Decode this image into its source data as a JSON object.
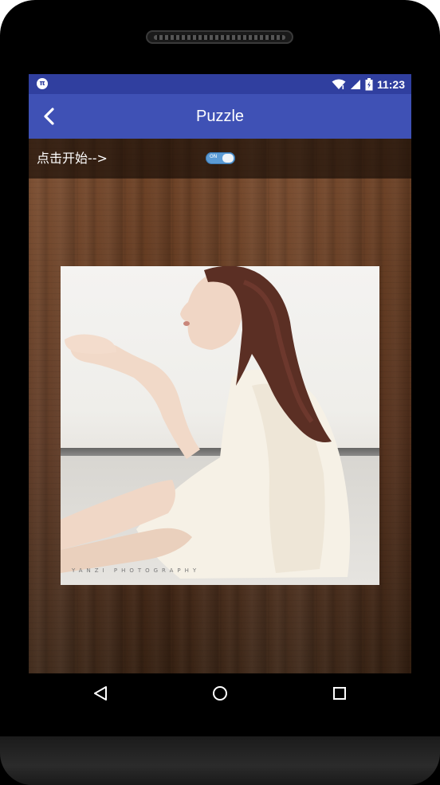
{
  "status_bar": {
    "app_icon_text": "π",
    "time": "11:23",
    "icons": [
      "wifi-icon",
      "signal-icon",
      "battery-icon"
    ]
  },
  "app_bar": {
    "title": "Puzzle",
    "back_icon": "chevron-left-icon"
  },
  "controls": {
    "start_label": "点击开始-->",
    "toggle_label": "ON",
    "toggle_state": true
  },
  "photo": {
    "watermark": "YANZI PHOTOGRAPHY"
  },
  "navigation": {
    "buttons": [
      "back-triangle-icon",
      "home-circle-icon",
      "recents-square-icon"
    ]
  },
  "colors": {
    "primary": "#3f51b5",
    "primary_dark": "#303f9f",
    "toggle": "#5b9bd5"
  }
}
